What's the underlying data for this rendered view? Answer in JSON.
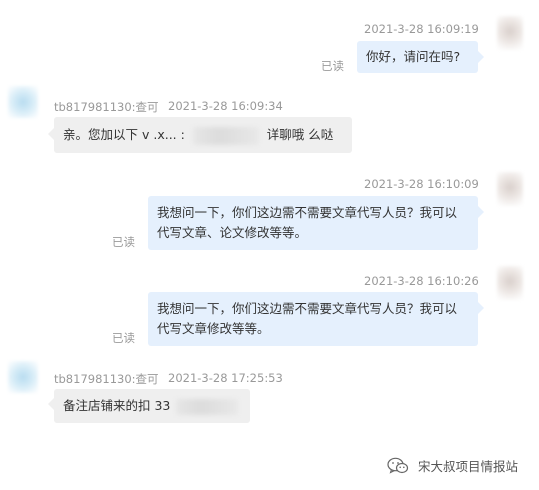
{
  "messages": [
    {
      "time": "2021-3-28 16:09:19",
      "text": "你好，请问在吗?",
      "status": "已读"
    },
    {
      "sender": "tb817981130:查可",
      "time": "2021-3-28 16:09:34",
      "text_before": "亲。您加以下 v .x... :",
      "text_after": "详聊哦  么哒"
    },
    {
      "time": "2021-3-28 16:10:09",
      "text": "我想问一下，你们这边需不需要文章代写人员？我可以代写文章、论文修改等等。",
      "status": "已读"
    },
    {
      "time": "2021-3-28 16:10:26",
      "text": "我想问一下，你们这边需不需要文章代写人员？我可以代写文章修改等等。",
      "status": "已读"
    },
    {
      "sender": "tb817981130:查可",
      "time": "2021-3-28 17:25:53",
      "text_before": "备注店铺来的扣 33"
    }
  ],
  "watermark": {
    "icon": "wechat-icon",
    "text": "宋大叔项目情报站"
  },
  "colors": {
    "outgoing_bubble": "#e5f0fd",
    "incoming_bubble": "#efefef",
    "meta_text": "#999999"
  }
}
